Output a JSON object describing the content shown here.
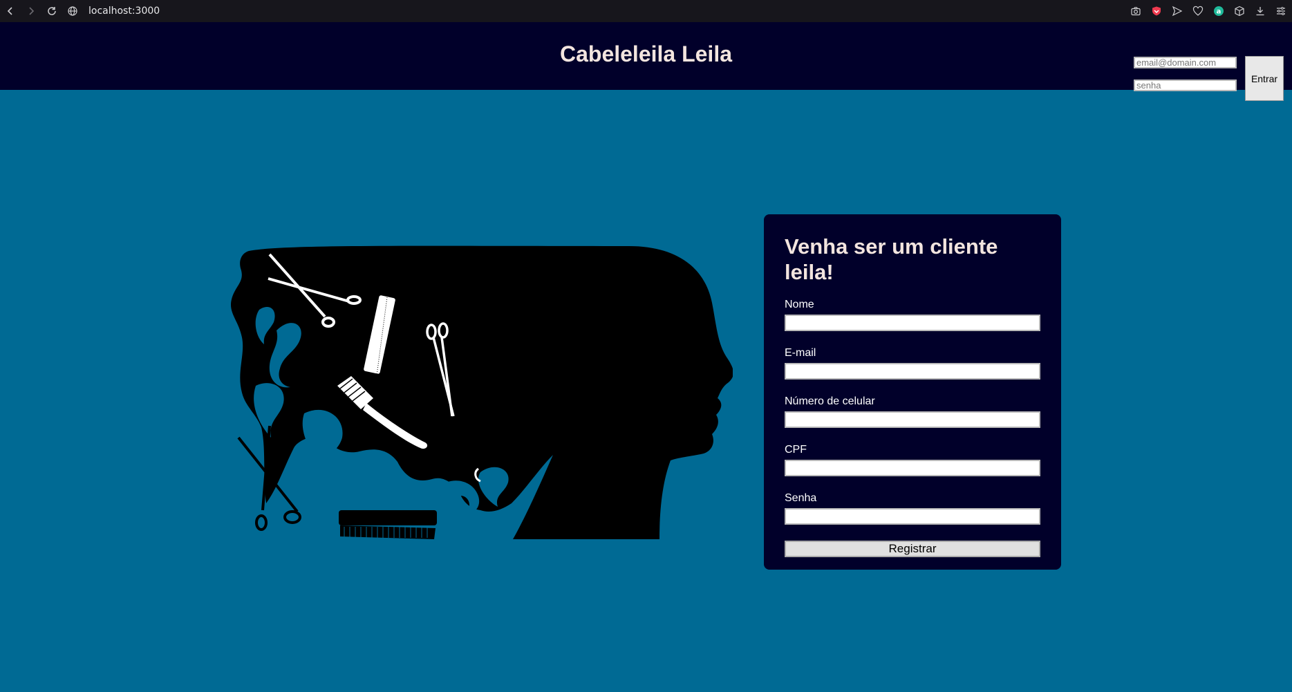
{
  "browser": {
    "url": "localhost:3000",
    "icons": [
      "back-icon",
      "forward-icon",
      "reload-icon",
      "globe-icon",
      "camera-icon",
      "shield-icon",
      "send-icon",
      "heart-icon",
      "a-icon",
      "cube-icon",
      "download-icon",
      "menu-icon"
    ]
  },
  "header": {
    "title": "Cabeleleila Leila",
    "email_placeholder": "email@domain.com",
    "password_placeholder": "senha",
    "login_label": "Entrar"
  },
  "hero": {
    "image": "salon-head-silhouette-with-scissors-and-combs"
  },
  "register": {
    "title": "Venha ser um cliente leila!",
    "fields": [
      {
        "label": "Nome",
        "value": ""
      },
      {
        "label": "E-mail",
        "value": ""
      },
      {
        "label": "Número de celular",
        "value": ""
      },
      {
        "label": "CPF",
        "value": ""
      },
      {
        "label": "Senha",
        "value": ""
      }
    ],
    "submit_label": "Registrar"
  },
  "colors": {
    "page_bg": "#006a94",
    "header_bg": "#01002a",
    "card_bg": "#01002a",
    "title_color": "#f3e5df"
  }
}
